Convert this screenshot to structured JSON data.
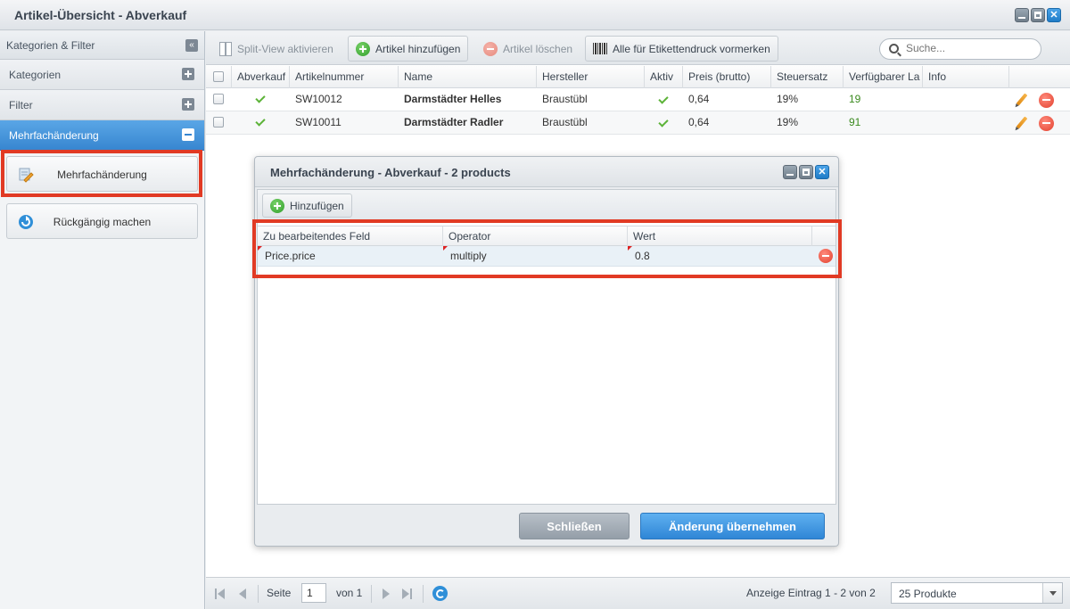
{
  "window": {
    "title": "Artikel-Übersicht - Abverkauf"
  },
  "sidebar": {
    "header": "Kategorien & Filter",
    "sections": [
      {
        "label": "Kategorien",
        "state": "collapsed"
      },
      {
        "label": "Filter",
        "state": "collapsed"
      },
      {
        "label": "Mehrfachänderung",
        "state": "expanded"
      }
    ],
    "buttons": [
      {
        "label": "Mehrfachänderung",
        "icon": "edit-pencil-icon"
      },
      {
        "label": "Rückgängig machen",
        "icon": "undo-icon"
      }
    ]
  },
  "toolbar": {
    "split_view": "Split-View aktivieren",
    "add_article": "Artikel hinzufügen",
    "delete_article": "Artikel löschen",
    "label_print": "Alle für Etikettendruck vormerken",
    "search_placeholder": "Suche..."
  },
  "grid": {
    "columns": [
      "Abverkauf",
      "Artikelnummer",
      "Name",
      "Hersteller",
      "Aktiv",
      "Preis (brutto)",
      "Steuersatz",
      "Verfügbarer La",
      "Info"
    ],
    "rows": [
      {
        "abverkauf": true,
        "number": "SW10012",
        "name": "Darmstädter Helles",
        "manufacturer": "Braustübl",
        "active": true,
        "price": "0,64",
        "tax": "19%",
        "stock": "19"
      },
      {
        "abverkauf": true,
        "number": "SW10011",
        "name": "Darmstädter Radler",
        "manufacturer": "Braustübl",
        "active": true,
        "price": "0,64",
        "tax": "19%",
        "stock": "91"
      }
    ]
  },
  "paging": {
    "page_label": "Seite",
    "page": "1",
    "of_label": "von 1",
    "display": "Anzeige Eintrag 1 - 2 von 2",
    "page_size": "25 Produkte"
  },
  "dialog": {
    "title": "Mehrfachänderung - Abverkauf - 2 products",
    "add_label": "Hinzufügen",
    "columns": [
      "Zu bearbeitendes Feld",
      "Operator",
      "Wert"
    ],
    "rows": [
      {
        "field": "Price.price",
        "operator": "multiply",
        "value": "0.8"
      }
    ],
    "close_label": "Schließen",
    "apply_label": "Änderung übernehmen"
  },
  "colors": {
    "accent": "#3786d0",
    "highlight": "#e13a24",
    "success": "#3b8a1f"
  }
}
